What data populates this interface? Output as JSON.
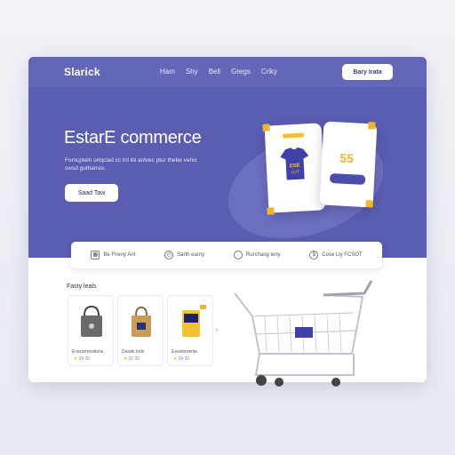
{
  "brand": "Slarick",
  "nav": [
    "Ham",
    "Shy",
    "Bell",
    "Gregs",
    "Criky"
  ],
  "top_button": "Bary Irata",
  "hero": {
    "headline": "EstarE commerce",
    "subtext": "Fomcpteln orlqclad cc tnl ibi anlvec ptur thebe vehic swsd gutharres.",
    "button": "Saad Taw"
  },
  "cards": {
    "shirt_text": "ESE LUT",
    "tag": "",
    "price": "55"
  },
  "features": [
    {
      "icon": "calendar-icon",
      "label": "Be Frieny Ant"
    },
    {
      "icon": "clock-icon",
      "label": "Sarth earny"
    },
    {
      "icon": "chat-icon",
      "label": "Rurchang leny"
    },
    {
      "icon": "money-icon",
      "label": "Cose Lly FCSOT"
    }
  ],
  "section_title": "Fasty leals",
  "products": [
    {
      "name": "Ecectemestions",
      "meta": "$4 $0"
    },
    {
      "name": "Dasde Irels",
      "meta": "$2 $0"
    },
    {
      "name": "Escetements",
      "meta": "$4 $0"
    }
  ],
  "colors": {
    "hero": "#5a5db0",
    "accent": "#f2b530"
  }
}
